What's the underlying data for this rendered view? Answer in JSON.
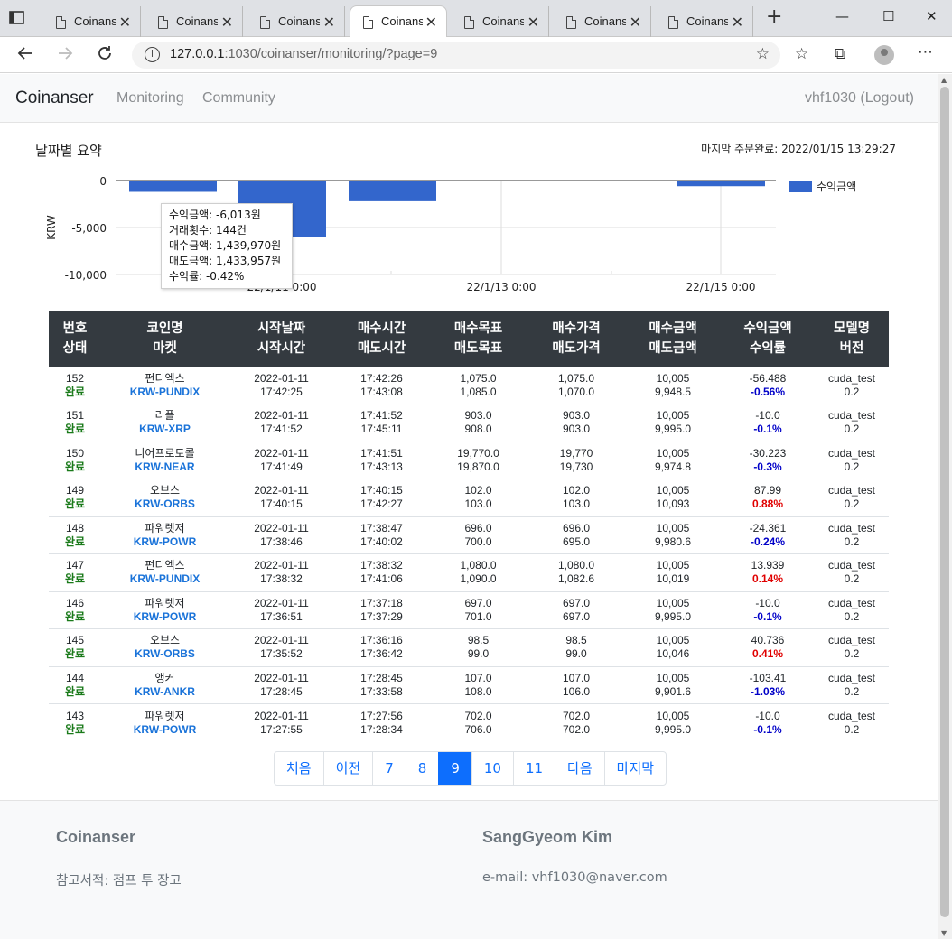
{
  "browser": {
    "tabs": [
      {
        "title": "Coinanser"
      },
      {
        "title": "Coinanser"
      },
      {
        "title": "Coinanser"
      },
      {
        "title": "Coinanser"
      },
      {
        "title": "Coinanser"
      },
      {
        "title": "Coinanser"
      },
      {
        "title": "Coinanser"
      }
    ],
    "url_host": "127.0.0.1",
    "url_rest": ":1030/coinanser/monitoring/?page=9",
    "new_tab": "+",
    "minimize": "—",
    "maximize": "☐",
    "close": "✕"
  },
  "navbar": {
    "brand": "Coinanser",
    "links": [
      "Monitoring",
      "Community"
    ],
    "user": "vhf1030 (Logout)"
  },
  "summary": {
    "title": "날짜별 요약",
    "last_order": "마지막 주문완료: 2022/01/15 13:29:27"
  },
  "chart_data": {
    "type": "bar",
    "ylabel": "KRW",
    "ylim": [
      -10000,
      0
    ],
    "yticks": [
      "0",
      "-5,000",
      "-10,000"
    ],
    "xticks": [
      "22/1/11 0:00",
      "22/1/13 0:00",
      "22/1/15 0:00"
    ],
    "legend": "수익금액",
    "color": "#3366cc",
    "values": [
      -1200,
      -6013,
      -2200,
      -600
    ]
  },
  "tooltip": [
    "수익금액: -6,013원",
    "거래횟수: 144건",
    "매수금액: 1,439,970원",
    "매도금액: 1,433,957원",
    "수익률: -0.42%"
  ],
  "table": {
    "headers": [
      [
        "번호",
        "상태"
      ],
      [
        "코인명",
        "마켓"
      ],
      [
        "시작날짜",
        "시작시간"
      ],
      [
        "매수시간",
        "매도시간"
      ],
      [
        "매수목표",
        "매도목표"
      ],
      [
        "매수가격",
        "매도가격"
      ],
      [
        "매수금액",
        "매도금액"
      ],
      [
        "수익금액",
        "수익률"
      ],
      [
        "모델명",
        "버전"
      ]
    ],
    "rows": [
      {
        "no": "152",
        "status": "완료",
        "coin": "펀디엑스",
        "market": "KRW-PUNDIX",
        "date": "2022-01-11",
        "time": "17:42:25",
        "buy_time": "17:42:26",
        "sell_time": "17:43:08",
        "buy_target": "1,075.0",
        "sell_target": "1,085.0",
        "buy_price": "1,075.0",
        "sell_price": "1,070.0",
        "buy_amt": "10,005",
        "sell_amt": "9,948.5",
        "profit": "-56.488",
        "rate": "-0.56%",
        "sign": "neg",
        "model": "cuda_test",
        "ver": "0.2"
      },
      {
        "no": "151",
        "status": "완료",
        "coin": "리플",
        "market": "KRW-XRP",
        "date": "2022-01-11",
        "time": "17:41:52",
        "buy_time": "17:41:52",
        "sell_time": "17:45:11",
        "buy_target": "903.0",
        "sell_target": "908.0",
        "buy_price": "903.0",
        "sell_price": "903.0",
        "buy_amt": "10,005",
        "sell_amt": "9,995.0",
        "profit": "-10.0",
        "rate": "-0.1%",
        "sign": "neg",
        "model": "cuda_test",
        "ver": "0.2"
      },
      {
        "no": "150",
        "status": "완료",
        "coin": "니어프로토콜",
        "market": "KRW-NEAR",
        "date": "2022-01-11",
        "time": "17:41:49",
        "buy_time": "17:41:51",
        "sell_time": "17:43:13",
        "buy_target": "19,770.0",
        "sell_target": "19,870.0",
        "buy_price": "19,770",
        "sell_price": "19,730",
        "buy_amt": "10,005",
        "sell_amt": "9,974.8",
        "profit": "-30.223",
        "rate": "-0.3%",
        "sign": "neg",
        "model": "cuda_test",
        "ver": "0.2"
      },
      {
        "no": "149",
        "status": "완료",
        "coin": "오브스",
        "market": "KRW-ORBS",
        "date": "2022-01-11",
        "time": "17:40:15",
        "buy_time": "17:40:15",
        "sell_time": "17:42:27",
        "buy_target": "102.0",
        "sell_target": "103.0",
        "buy_price": "102.0",
        "sell_price": "103.0",
        "buy_amt": "10,005",
        "sell_amt": "10,093",
        "profit": "87.99",
        "rate": "0.88%",
        "sign": "pos",
        "model": "cuda_test",
        "ver": "0.2"
      },
      {
        "no": "148",
        "status": "완료",
        "coin": "파워렛저",
        "market": "KRW-POWR",
        "date": "2022-01-11",
        "time": "17:38:46",
        "buy_time": "17:38:47",
        "sell_time": "17:40:02",
        "buy_target": "696.0",
        "sell_target": "700.0",
        "buy_price": "696.0",
        "sell_price": "695.0",
        "buy_amt": "10,005",
        "sell_amt": "9,980.6",
        "profit": "-24.361",
        "rate": "-0.24%",
        "sign": "neg",
        "model": "cuda_test",
        "ver": "0.2"
      },
      {
        "no": "147",
        "status": "완료",
        "coin": "펀디엑스",
        "market": "KRW-PUNDIX",
        "date": "2022-01-11",
        "time": "17:38:32",
        "buy_time": "17:38:32",
        "sell_time": "17:41:06",
        "buy_target": "1,080.0",
        "sell_target": "1,090.0",
        "buy_price": "1,080.0",
        "sell_price": "1,082.6",
        "buy_amt": "10,005",
        "sell_amt": "10,019",
        "profit": "13.939",
        "rate": "0.14%",
        "sign": "pos",
        "model": "cuda_test",
        "ver": "0.2"
      },
      {
        "no": "146",
        "status": "완료",
        "coin": "파워렛저",
        "market": "KRW-POWR",
        "date": "2022-01-11",
        "time": "17:36:51",
        "buy_time": "17:37:18",
        "sell_time": "17:37:29",
        "buy_target": "697.0",
        "sell_target": "701.0",
        "buy_price": "697.0",
        "sell_price": "697.0",
        "buy_amt": "10,005",
        "sell_amt": "9,995.0",
        "profit": "-10.0",
        "rate": "-0.1%",
        "sign": "neg",
        "model": "cuda_test",
        "ver": "0.2"
      },
      {
        "no": "145",
        "status": "완료",
        "coin": "오브스",
        "market": "KRW-ORBS",
        "date": "2022-01-11",
        "time": "17:35:52",
        "buy_time": "17:36:16",
        "sell_time": "17:36:42",
        "buy_target": "98.5",
        "sell_target": "99.0",
        "buy_price": "98.5",
        "sell_price": "99.0",
        "buy_amt": "10,005",
        "sell_amt": "10,046",
        "profit": "40.736",
        "rate": "0.41%",
        "sign": "pos",
        "model": "cuda_test",
        "ver": "0.2"
      },
      {
        "no": "144",
        "status": "완료",
        "coin": "앵커",
        "market": "KRW-ANKR",
        "date": "2022-01-11",
        "time": "17:28:45",
        "buy_time": "17:28:45",
        "sell_time": "17:33:58",
        "buy_target": "107.0",
        "sell_target": "108.0",
        "buy_price": "107.0",
        "sell_price": "106.0",
        "buy_amt": "10,005",
        "sell_amt": "9,901.6",
        "profit": "-103.41",
        "rate": "-1.03%",
        "sign": "neg",
        "model": "cuda_test",
        "ver": "0.2"
      },
      {
        "no": "143",
        "status": "완료",
        "coin": "파워렛저",
        "market": "KRW-POWR",
        "date": "2022-01-11",
        "time": "17:27:55",
        "buy_time": "17:27:56",
        "sell_time": "17:28:34",
        "buy_target": "702.0",
        "sell_target": "706.0",
        "buy_price": "702.0",
        "sell_price": "702.0",
        "buy_amt": "10,005",
        "sell_amt": "9,995.0",
        "profit": "-10.0",
        "rate": "-0.1%",
        "sign": "neg",
        "model": "cuda_test",
        "ver": "0.2"
      }
    ]
  },
  "pagination": {
    "items": [
      "처음",
      "이전",
      "7",
      "8",
      "9",
      "10",
      "11",
      "다음",
      "마지막"
    ],
    "active": "9"
  },
  "footer": {
    "left_title": "Coinanser",
    "left_text": "참고서적: 점프 투 장고",
    "right_title": "SangGyeom Kim",
    "right_text": "e-mail: vhf1030@naver.com"
  }
}
